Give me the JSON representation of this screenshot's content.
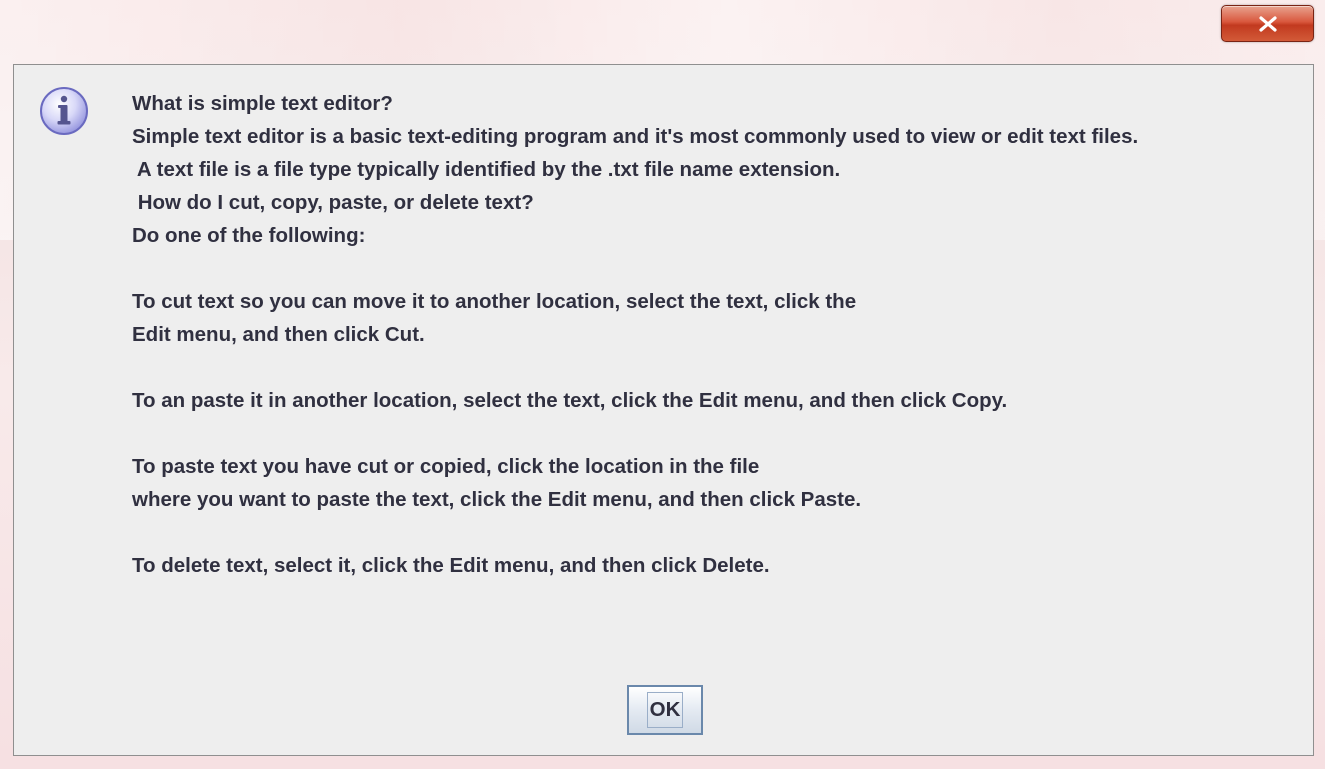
{
  "window": {
    "close_label": "x"
  },
  "dialog": {
    "icon": "info-icon",
    "lines": [
      "What is simple text editor?",
      "Simple text editor is a basic text-editing program and it's most commonly used to view or edit text files.",
      " A text file is a file type typically identified by the .txt file name extension.",
      " How do I cut, copy, paste, or delete text?",
      "Do one of the following:",
      "",
      "To cut text so you can move it to another location, select the text, click the",
      "Edit menu, and then click Cut.",
      "",
      "To an paste it in another location, select the text, click the Edit menu, and then click Copy.",
      "",
      "To paste text you have cut or copied, click the location in the file",
      "where you want to paste the text, click the Edit menu, and then click Paste.",
      "",
      "To delete text, select it, click the Edit menu, and then click Delete."
    ],
    "ok_label": "OK"
  },
  "colors": {
    "close_button": "#c9452a",
    "panel_background": "#eeeeee",
    "text": "#303040",
    "ok_border": "#6a88ab"
  }
}
